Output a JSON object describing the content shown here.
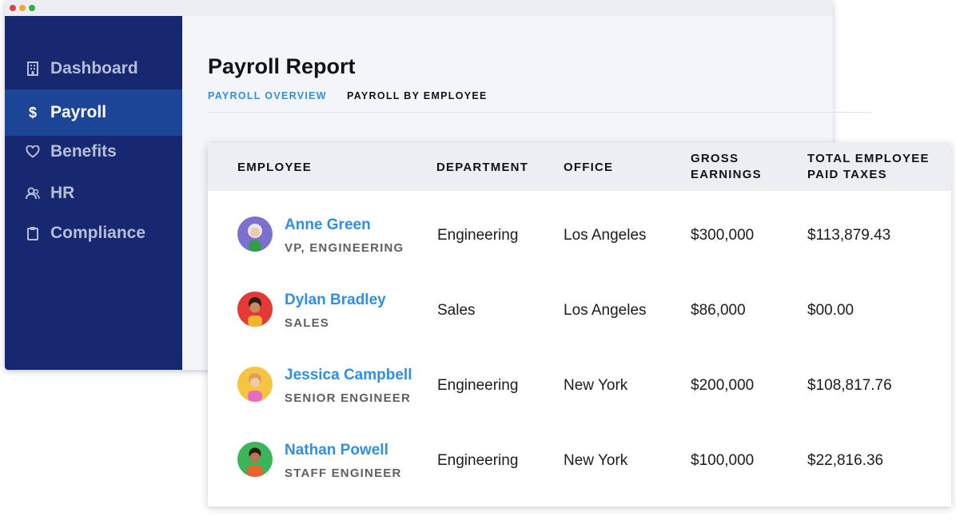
{
  "sidebar": {
    "items": [
      {
        "label": "Dashboard",
        "icon": "building-icon",
        "active": false
      },
      {
        "label": "Payroll",
        "icon": "dollar-icon",
        "active": true
      },
      {
        "label": "Benefits",
        "icon": "heart-icon",
        "active": false
      },
      {
        "label": "HR",
        "icon": "people-icon",
        "active": false
      },
      {
        "label": "Compliance",
        "icon": "clipboard-icon",
        "active": false
      }
    ]
  },
  "main": {
    "title": "Payroll Report",
    "tabs": [
      {
        "label": "PAYROLL OVERVIEW",
        "active": true
      },
      {
        "label": "PAYROLL BY EMPLOYEE",
        "active": false
      }
    ]
  },
  "table": {
    "headers": {
      "employee": "EMPLOYEE",
      "department": "DEPARTMENT",
      "office": "OFFICE",
      "gross_line1": "GROSS",
      "gross_line2": "EARNINGS",
      "taxes_line1": "TOTAL EMPLOYEE",
      "taxes_line2": "PAID TAXES"
    },
    "rows": [
      {
        "name": "Anne Green",
        "title": "VP, ENGINEERING",
        "department": "Engineering",
        "office": "Los Angeles",
        "gross": "$300,000",
        "taxes": "$113,879.43",
        "avatar_bg": "#7b6fd0"
      },
      {
        "name": "Dylan Bradley",
        "title": "SALES",
        "department": "Sales",
        "office": "Los Angeles",
        "gross": "$86,000",
        "taxes": "$00.00",
        "avatar_bg": "#e53935"
      },
      {
        "name": "Jessica Campbell",
        "title": "SENIOR ENGINEER",
        "department": "Engineering",
        "office": "New York",
        "gross": "$200,000",
        "taxes": "$108,817.76",
        "avatar_bg": "#f5c542"
      },
      {
        "name": "Nathan Powell",
        "title": "STAFF ENGINEER",
        "department": "Engineering",
        "office": "New York",
        "gross": "$100,000",
        "taxes": "$22,816.36",
        "avatar_bg": "#3bb55a"
      }
    ]
  },
  "colors": {
    "sidebar_bg": "#172770",
    "sidebar_active": "#1d4597",
    "accent_blue": "#2f8fe0"
  }
}
